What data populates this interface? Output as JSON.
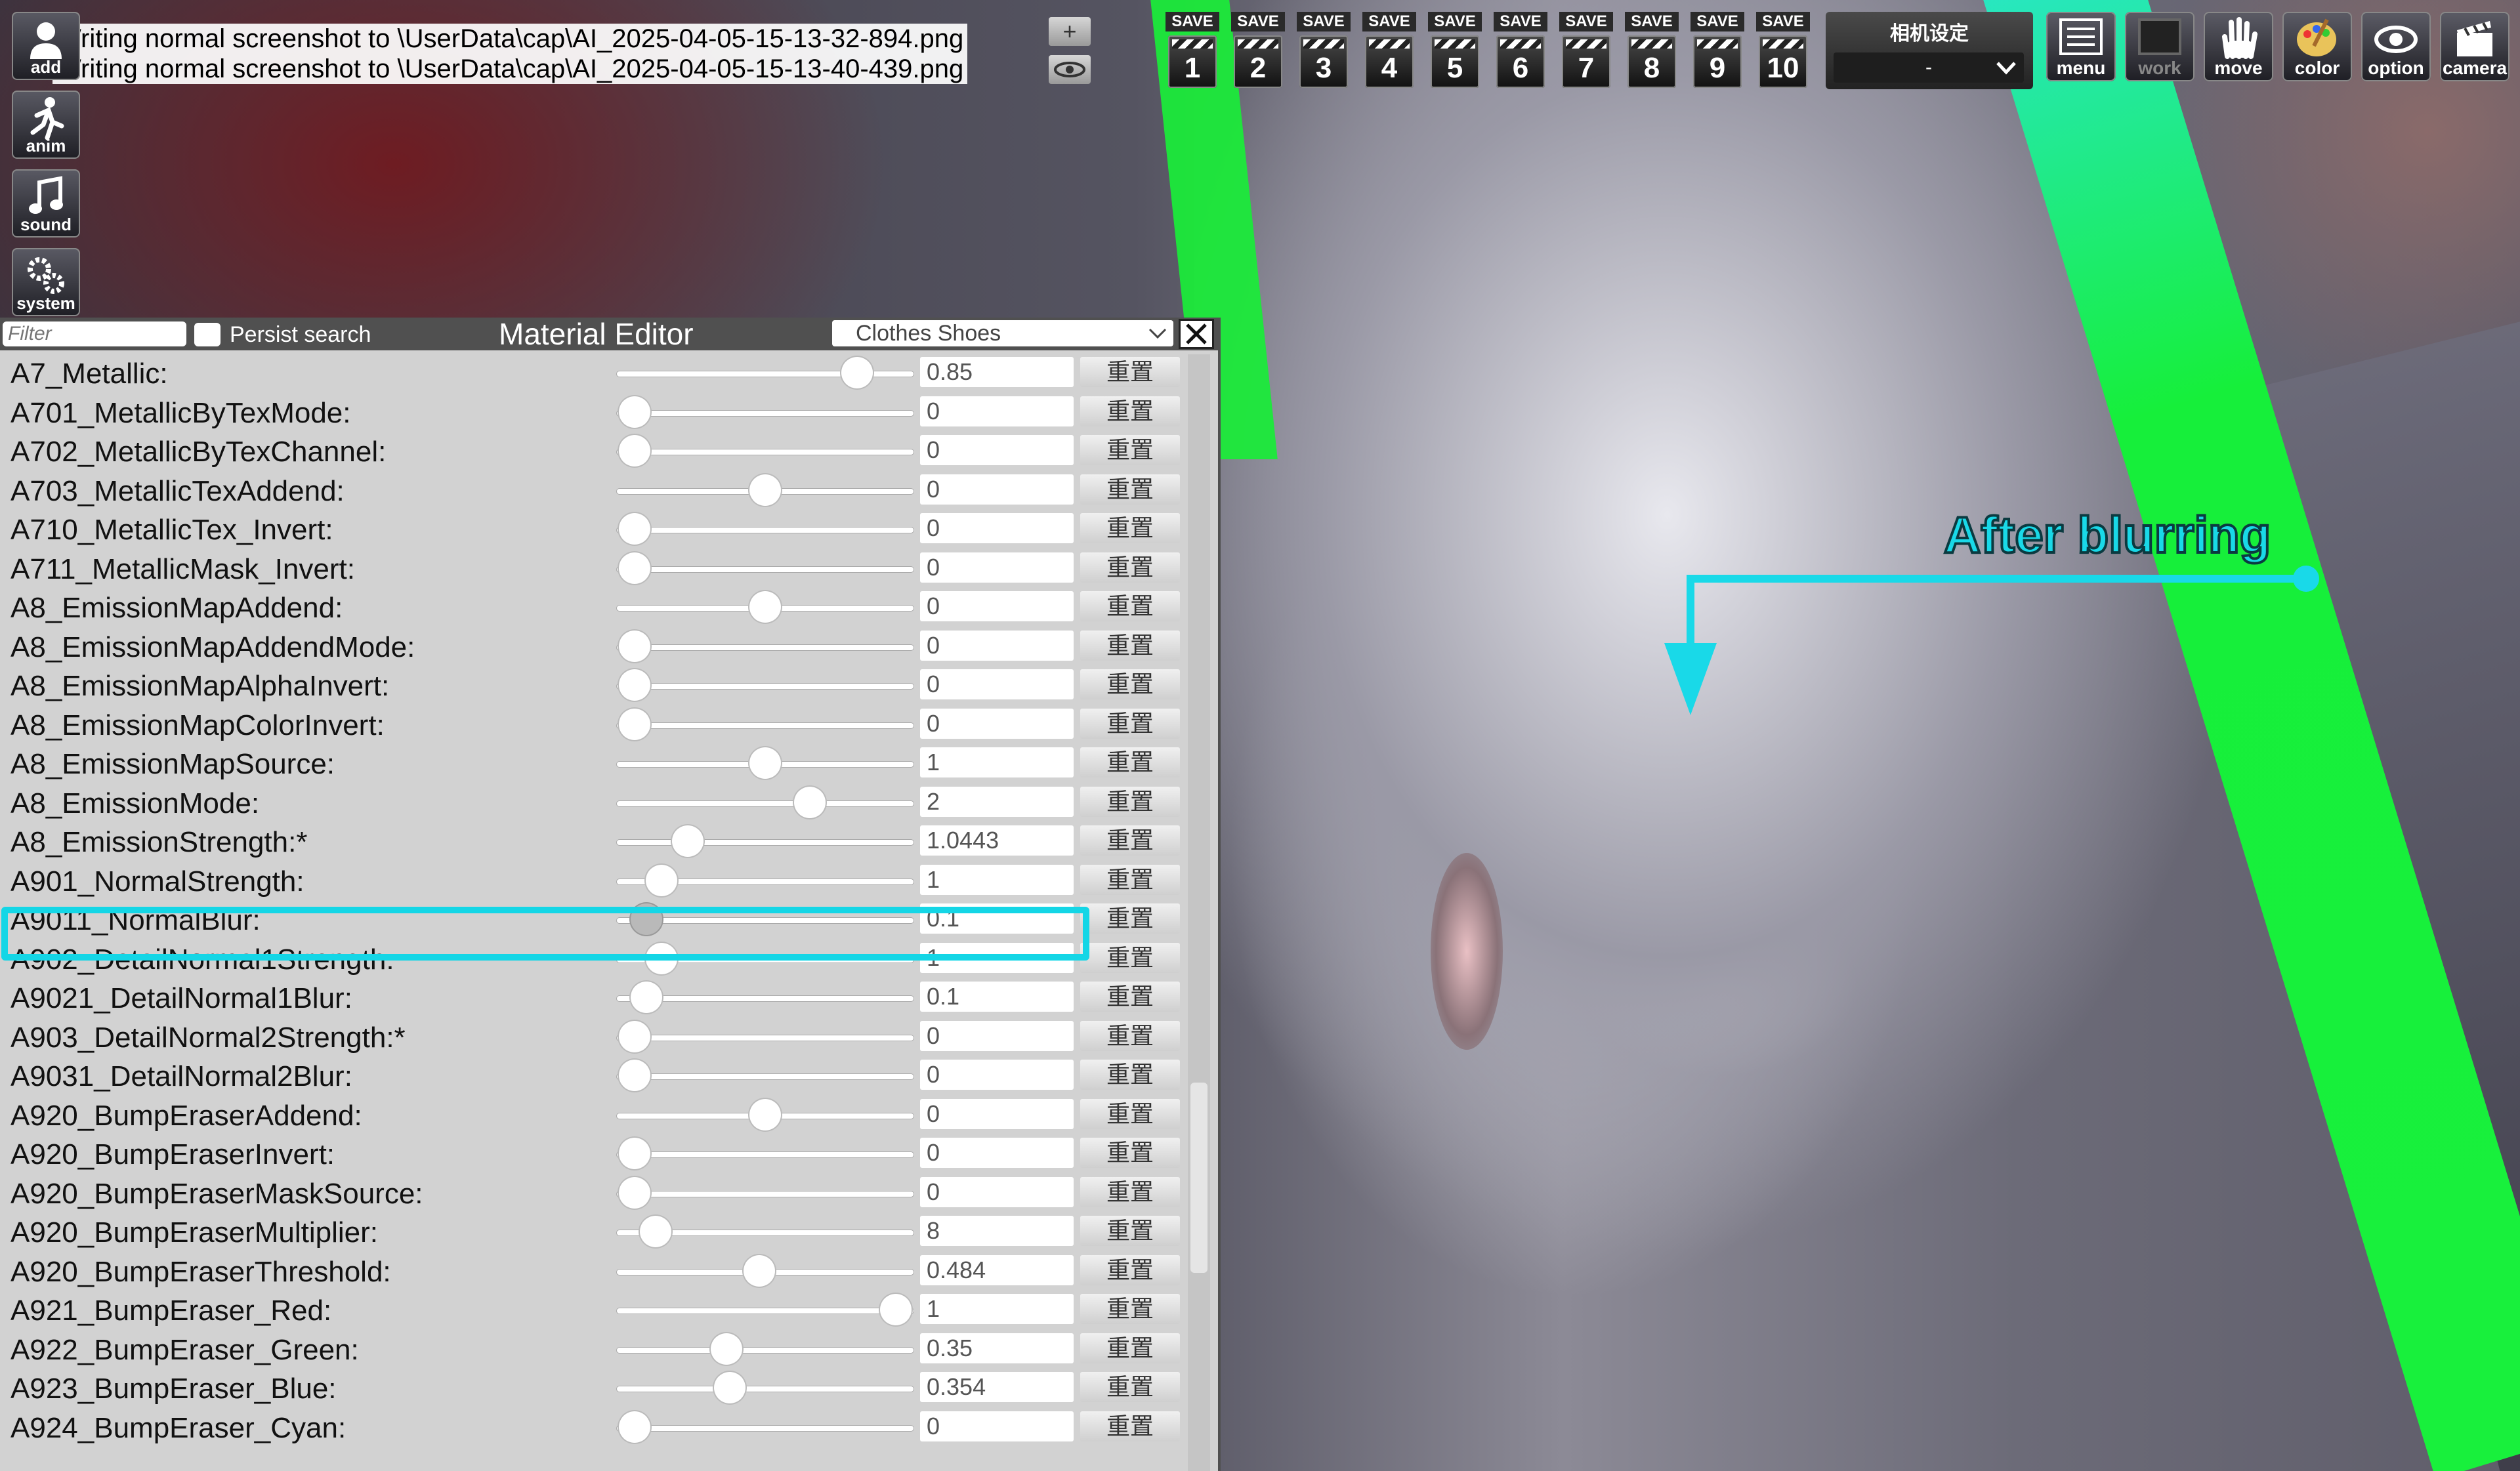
{
  "status_messages": [
    "Writing normal screenshot to \\UserData\\cap\\AI_2025-04-05-15-13-32-894.png",
    "Writing normal screenshot to \\UserData\\cap\\AI_2025-04-05-15-13-40-439.png"
  ],
  "left_toolbar": [
    {
      "label": "add",
      "icon": "add-person-icon"
    },
    {
      "label": "anim",
      "icon": "running-person-icon"
    },
    {
      "label": "sound",
      "icon": "music-note-icon"
    },
    {
      "label": "system",
      "icon": "gears-icon"
    }
  ],
  "mini_buttons": {
    "plus": "+",
    "eye": "eye-icon"
  },
  "save_slots": {
    "label": "SAVE",
    "numbers": [
      "1",
      "2",
      "3",
      "4",
      "5",
      "6",
      "7",
      "8",
      "9",
      "10"
    ]
  },
  "camera_settings": {
    "title": "相机设定",
    "value": "-"
  },
  "right_toolbar": [
    {
      "label": "menu",
      "icon": "menu-list-icon"
    },
    {
      "label": "work",
      "icon": "work-frame-icon"
    },
    {
      "label": "move",
      "icon": "hand-icon"
    },
    {
      "label": "color",
      "icon": "palette-icon"
    },
    {
      "label": "option",
      "icon": "eye-icon"
    },
    {
      "label": "camera",
      "icon": "clapper-camera-icon"
    }
  ],
  "material_editor": {
    "filter_placeholder": "Filter",
    "persist_label": "Persist search",
    "title": "Material Editor",
    "category": "Clothes Shoes",
    "reset_label": "重置",
    "params": [
      {
        "name": "A7_Metallic:",
        "value": "0.85",
        "level": 0.81
      },
      {
        "name": "A701_MetallicByTexMode:",
        "value": "0",
        "level": 0.06
      },
      {
        "name": "A702_MetallicByTexChannel:",
        "value": "0",
        "level": 0.06
      },
      {
        "name": "A703_MetallicTexAddend:",
        "value": "0",
        "level": 0.5
      },
      {
        "name": "A710_MetallicTex_Invert:",
        "value": "0",
        "level": 0.06
      },
      {
        "name": "A711_MetallicMask_Invert:",
        "value": "0",
        "level": 0.06
      },
      {
        "name": "A8_EmissionMapAddend:",
        "value": "0",
        "level": 0.5
      },
      {
        "name": "A8_EmissionMapAddendMode:",
        "value": "0",
        "level": 0.06
      },
      {
        "name": "A8_EmissionMapAlphaInvert:",
        "value": "0",
        "level": 0.06
      },
      {
        "name": "A8_EmissionMapColorInvert:",
        "value": "0",
        "level": 0.06
      },
      {
        "name": "A8_EmissionMapSource:",
        "value": "1",
        "level": 0.5
      },
      {
        "name": "A8_EmissionMode:",
        "value": "2",
        "level": 0.65
      },
      {
        "name": "A8_EmissionStrength:*",
        "value": "1.0443",
        "level": 0.24
      },
      {
        "name": "A901_NormalStrength:",
        "value": "1",
        "level": 0.15
      },
      {
        "name": "A9011_NormalBlur:",
        "value": "0.1",
        "level": 0.1,
        "highlighted": true
      },
      {
        "name": "A902_DetailNormal1Strength:",
        "value": "1",
        "level": 0.15
      },
      {
        "name": "A9021_DetailNormal1Blur:",
        "value": "0.1",
        "level": 0.1
      },
      {
        "name": "A903_DetailNormal2Strength:*",
        "value": "0",
        "level": 0.06
      },
      {
        "name": "A9031_DetailNormal2Blur:",
        "value": "0",
        "level": 0.06
      },
      {
        "name": "A920_BumpEraserAddend:",
        "value": "0",
        "level": 0.5
      },
      {
        "name": "A920_BumpEraserInvert:",
        "value": "0",
        "level": 0.06
      },
      {
        "name": "A920_BumpEraserMaskSource:",
        "value": "0",
        "level": 0.06
      },
      {
        "name": "A920_BumpEraserMultiplier:",
        "value": "8",
        "level": 0.13
      },
      {
        "name": "A920_BumpEraserThreshold:",
        "value": "0.484",
        "level": 0.48
      },
      {
        "name": "A921_BumpEraser_Red:",
        "value": "1",
        "level": 0.94
      },
      {
        "name": "A922_BumpEraser_Green:",
        "value": "0.35",
        "level": 0.37
      },
      {
        "name": "A923_BumpEraser_Blue:",
        "value": "0.354",
        "level": 0.38
      },
      {
        "name": "A924_BumpEraser_Cyan:",
        "value": "0",
        "level": 0.06
      }
    ]
  },
  "annotation": {
    "text": "After blurring",
    "color": "#19d9e8"
  },
  "colors": {
    "highlight": "#14d6e6",
    "green_band": "#18f03c"
  }
}
